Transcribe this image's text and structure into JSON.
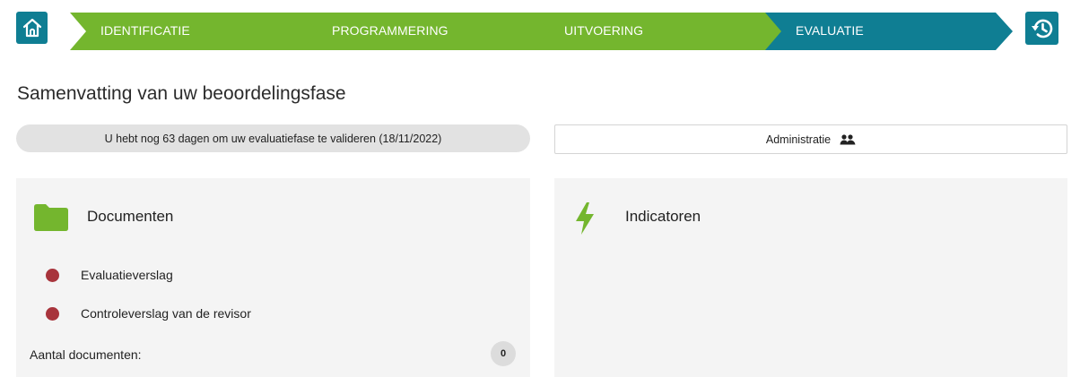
{
  "nav": {
    "steps": [
      {
        "label": "IDENTIFICATIE",
        "state": "done"
      },
      {
        "label": "PROGRAMMERING",
        "state": "done"
      },
      {
        "label": "UITVOERING",
        "state": "done"
      },
      {
        "label": "EVALUATIE",
        "state": "active"
      }
    ],
    "home_icon": "home-icon",
    "history_icon": "history-icon"
  },
  "colors": {
    "step_done": "#74b62e",
    "step_active": "#0f7e93",
    "status_dot": "#a8343c",
    "folder": "#74b62e"
  },
  "page": {
    "title": "Samenvatting van uw beoordelingsfase"
  },
  "deadline": {
    "text": "U hebt nog 63 dagen om uw evaluatiefase te valideren (18/11/2022)"
  },
  "admin": {
    "label": "Administratie",
    "icon": "users-icon"
  },
  "documents": {
    "title": "Documenten",
    "icon": "folder-icon",
    "items": [
      {
        "label": "Evaluatieverslag"
      },
      {
        "label": "Controleverslag van de revisor"
      }
    ],
    "count_label": "Aantal documenten:",
    "count": "0"
  },
  "indicators": {
    "title": "Indicatoren",
    "icon": "lightning-icon"
  }
}
